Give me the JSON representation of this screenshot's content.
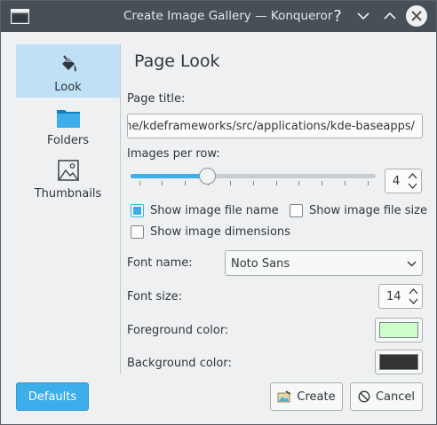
{
  "window": {
    "title": "Create Image Gallery — Konqueror"
  },
  "sidebar": {
    "items": [
      {
        "label": "Look",
        "icon": "paint-bucket-icon",
        "active": true
      },
      {
        "label": "Folders",
        "icon": "folder-icon",
        "active": false
      },
      {
        "label": "Thumbnails",
        "icon": "image-icon",
        "active": false
      }
    ]
  },
  "main": {
    "heading": "Page Look",
    "page_title_label": "Page title:",
    "page_title_value": "/home/kdeframeworks/src/applications/kde-baseapps/",
    "images_per_row_label": "Images per row:",
    "images_per_row_value": "4",
    "images_per_row_slider": {
      "min": 1,
      "max": 11,
      "value": 4
    },
    "show_file_name": {
      "label": "Show image file name",
      "checked": true
    },
    "show_file_size": {
      "label": "Show image file size",
      "checked": false
    },
    "show_dimensions": {
      "label": "Show image dimensions",
      "checked": false
    },
    "font_name_label": "Font name:",
    "font_name_value": "Noto Sans",
    "font_size_label": "Font size:",
    "font_size_value": "14",
    "foreground_label": "Foreground color:",
    "foreground_color": "#ccffcc",
    "background_label": "Background color:",
    "background_color": "#333333"
  },
  "buttons": {
    "defaults": "Defaults",
    "create": "Create",
    "cancel": "Cancel"
  },
  "colors": {
    "accent": "#3daee9",
    "titlebar": "#475057"
  }
}
